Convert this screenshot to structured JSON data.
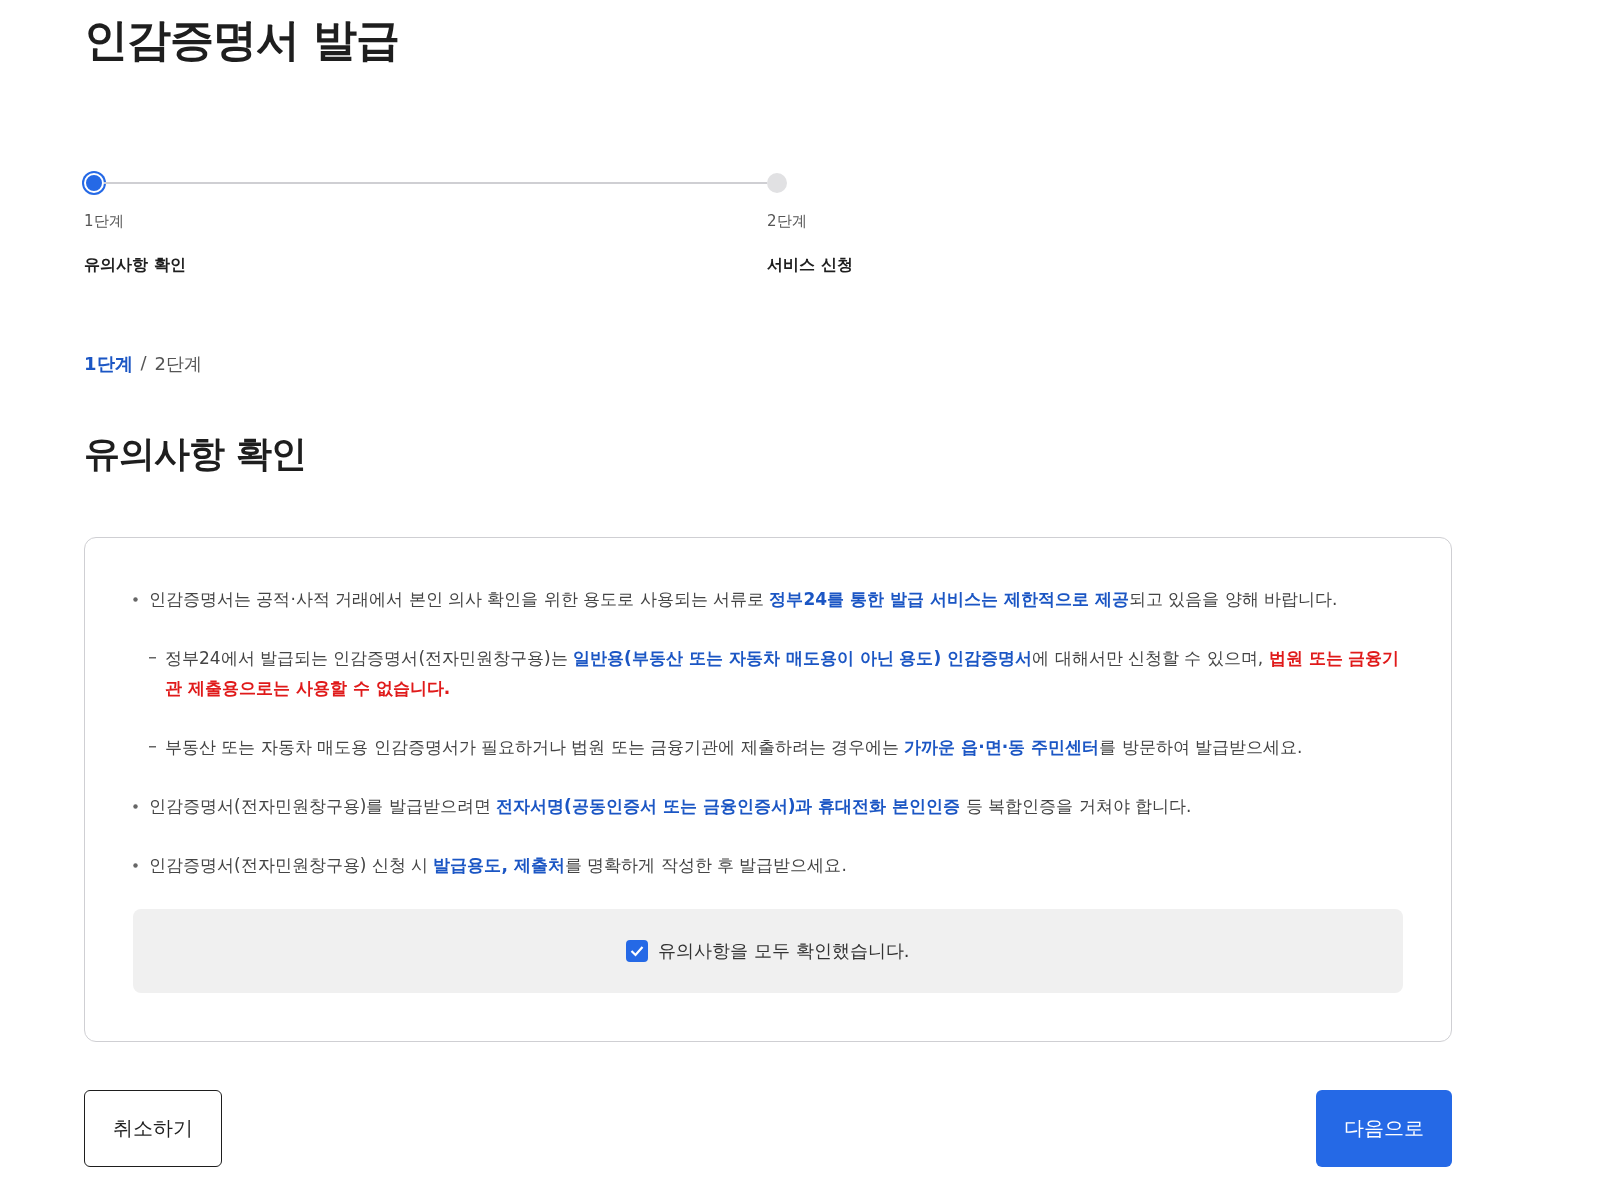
{
  "page_title": "인감증명서 발급",
  "steps": [
    {
      "number": "1단계",
      "label": "유의사항 확인",
      "selected": true
    },
    {
      "number": "2단계",
      "label": "서비스 신청",
      "selected": false
    }
  ],
  "step_indicator": {
    "current": "1단계",
    "separator": "/",
    "total": "2단계"
  },
  "section_title": "유의사항 확인",
  "notices": [
    {
      "kind": "bullet",
      "segments": [
        {
          "text": "인감증명서는 공적·사적 거래에서 본인 의사 확인을 위한 용도로 사용되는 서류로 ",
          "kind": "plain"
        },
        {
          "text": "정부24를 통한 발급 서비스는 제한적으로 제공",
          "kind": "emphasis"
        },
        {
          "text": "되고 있음을 양해 바랍니다.",
          "kind": "plain"
        }
      ]
    },
    {
      "kind": "dash",
      "segments": [
        {
          "text": "정부24에서 발급되는 인감증명서(전자민원창구용)는 ",
          "kind": "plain"
        },
        {
          "text": "일반용(부동산 또는 자동차 매도용이 아닌 용도) 인감증명서",
          "kind": "emphasis"
        },
        {
          "text": "에 대해서만 신청할 수 있으며, ",
          "kind": "plain"
        },
        {
          "text": "법원 또는 금융기관 제출용으로는 사용할 수 없습니다.",
          "kind": "warning"
        }
      ]
    },
    {
      "kind": "dash",
      "segments": [
        {
          "text": "부동산 또는 자동차 매도용 인감증명서가 필요하거나 법원 또는 금융기관에 제출하려는 경우에는 ",
          "kind": "plain"
        },
        {
          "text": "가까운 읍·면·동 주민센터",
          "kind": "emphasis"
        },
        {
          "text": "를 방문하여 발급받으세요.",
          "kind": "plain"
        }
      ]
    },
    {
      "kind": "bullet",
      "segments": [
        {
          "text": "인감증명서(전자민원창구용)를 발급받으려면 ",
          "kind": "plain"
        },
        {
          "text": "전자서명(공동인증서 또는 금융인증서)과 휴대전화 본인인증",
          "kind": "emphasis"
        },
        {
          "text": " 등 복합인증을 거쳐야 합니다.",
          "kind": "plain"
        }
      ]
    },
    {
      "kind": "bullet",
      "segments": [
        {
          "text": "인감증명서(전자민원창구용) 신청 시 ",
          "kind": "plain"
        },
        {
          "text": "발급용도, 제출처",
          "kind": "emphasis"
        },
        {
          "text": "를 명확하게 작성한 후 발급받으세요.",
          "kind": "plain"
        }
      ]
    }
  ],
  "agreement": {
    "label": "유의사항을 모두 확인했습니다.",
    "checked": true
  },
  "buttons": {
    "cancel": "취소하기",
    "next": "다음으로"
  }
}
